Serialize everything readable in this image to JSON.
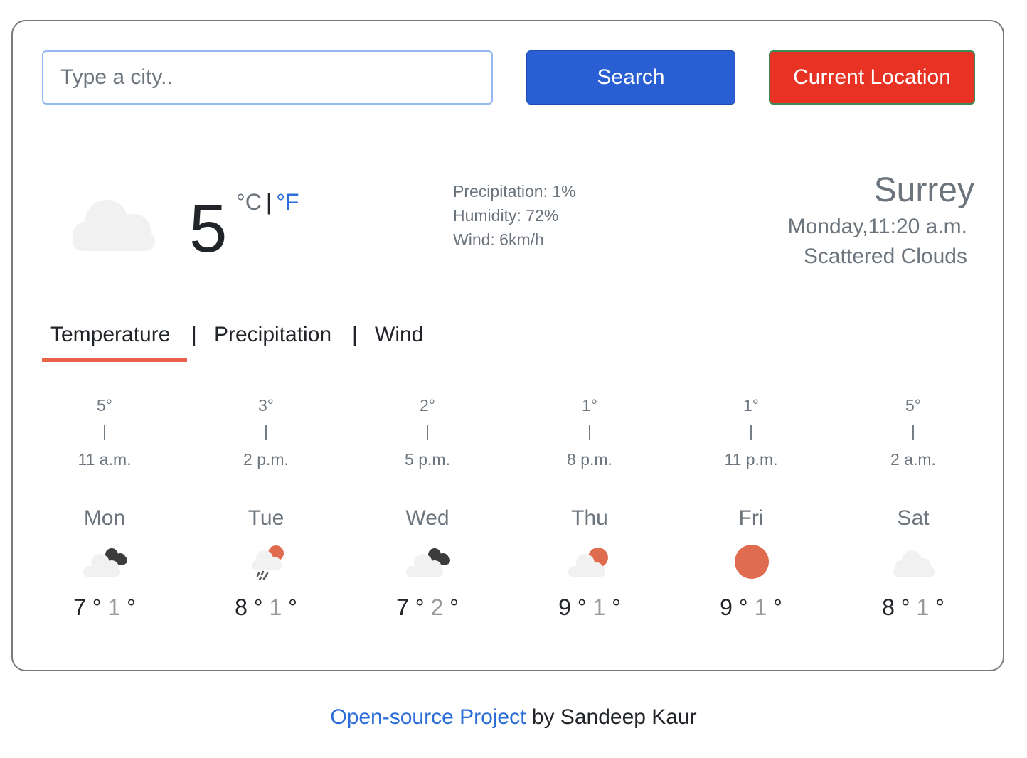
{
  "search": {
    "placeholder": "Type a city..",
    "button_label": "Search",
    "location_button_label": "Current Location"
  },
  "current": {
    "temperature": "5",
    "unit_celsius": "°C",
    "unit_separator": "|",
    "unit_fahrenheit": "°F",
    "icon": "cloud-icon",
    "precipitation": "Precipitation: 1%",
    "humidity": "Humidity: 72%",
    "wind": "Wind: 6km/h",
    "city": "Surrey",
    "datetime": "Monday,11:20 a.m.",
    "description": "Scattered Clouds"
  },
  "tabs": [
    {
      "label": "Temperature",
      "active": true
    },
    {
      "label": "Precipitation",
      "active": false
    },
    {
      "label": "Wind",
      "active": false
    }
  ],
  "tab_separator": "|",
  "hourly": [
    {
      "temp": "5°",
      "bar": "|",
      "time": "11 a.m."
    },
    {
      "temp": "3°",
      "bar": "|",
      "time": "2 p.m."
    },
    {
      "temp": "2°",
      "bar": "|",
      "time": "5 p.m."
    },
    {
      "temp": "1°",
      "bar": "|",
      "time": "8 p.m."
    },
    {
      "temp": "1°",
      "bar": "|",
      "time": "11 p.m."
    },
    {
      "temp": "5°",
      "bar": "|",
      "time": "2 a.m."
    }
  ],
  "daily": [
    {
      "day": "Mon",
      "icon": "cloud-dark-cloud-icon",
      "high": "7",
      "low": "1"
    },
    {
      "day": "Tue",
      "icon": "rain-sun-cloud-icon",
      "high": "8",
      "low": "1"
    },
    {
      "day": "Wed",
      "icon": "cloud-dark-cloud-icon",
      "high": "7",
      "low": "2"
    },
    {
      "day": "Thu",
      "icon": "sun-behind-cloud-icon",
      "high": "9",
      "low": "1"
    },
    {
      "day": "Fri",
      "icon": "sun-icon",
      "high": "9",
      "low": "1"
    },
    {
      "day": "Sat",
      "icon": "cloud-icon",
      "high": "8",
      "low": "1"
    }
  ],
  "degree_symbol": "°",
  "footer": {
    "link_text": "Open-source Project",
    "suffix": " by Sandeep Kaur"
  },
  "colors": {
    "accent": "#e8634a",
    "search_button": "#2a5fd3",
    "location_button": "#e83224",
    "link": "#2a6cd8",
    "sun": "#e06c4f",
    "cloud": "#f1f1f1",
    "dark_cloud": "#3c3c3c"
  }
}
